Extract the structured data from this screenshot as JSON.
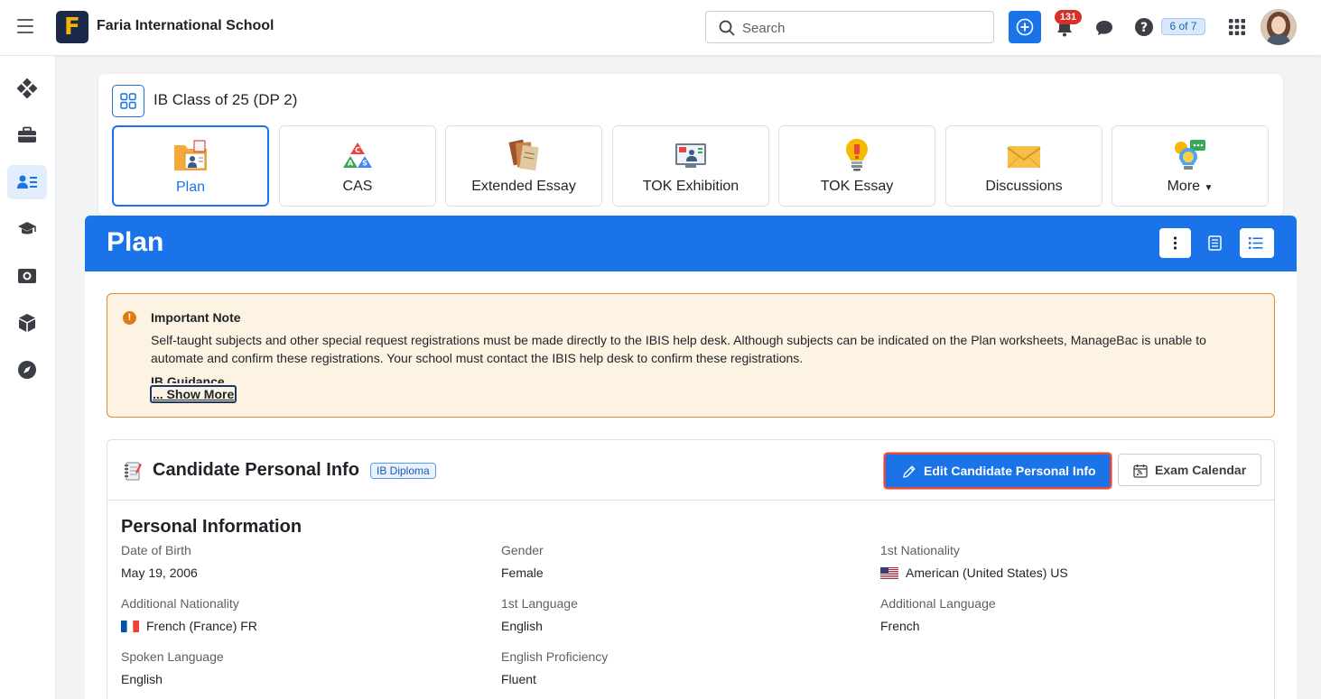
{
  "header": {
    "school_name": "Faria International School",
    "search_placeholder": "Search",
    "notifications_count": "131",
    "pager": "6 of 7"
  },
  "sidebar": {
    "items": [
      {
        "icon": "diamond-grid-icon"
      },
      {
        "icon": "briefcase-icon"
      },
      {
        "icon": "student-card-icon",
        "active": true
      },
      {
        "icon": "graduation-cap-icon"
      },
      {
        "icon": "book-globe-icon"
      },
      {
        "icon": "cube-icon"
      },
      {
        "icon": "compass-icon"
      }
    ]
  },
  "class": {
    "title": "IB Class of 25 (DP 2)",
    "tabs": [
      {
        "label": "Plan",
        "icon": "plan-folder-icon",
        "active": true
      },
      {
        "label": "CAS",
        "icon": "cas-triangle-icon"
      },
      {
        "label": "Extended Essay",
        "icon": "extended-essay-books-icon"
      },
      {
        "label": "TOK Exhibition",
        "icon": "tok-exhibition-screen-icon"
      },
      {
        "label": "TOK Essay",
        "icon": "tok-essay-lightbulb-icon"
      },
      {
        "label": "Discussions",
        "icon": "discussions-envelope-icon"
      },
      {
        "label": "More",
        "icon": "more-bulb-chat-icon",
        "dropdown": true
      }
    ]
  },
  "plan": {
    "title": "Plan"
  },
  "note": {
    "title": "Important Note",
    "body": "Self-taught subjects and other special request registrations must be made directly to the IBIS help desk. Although subjects can be indicated on the Plan worksheets, ManageBac is unable to automate and confirm these registrations. Your school must contact the IBIS help desk to confirm these registrations.",
    "subheading": "IB Guidance",
    "show_more": "... Show More"
  },
  "candidate": {
    "title": "Candidate Personal Info",
    "badge": "IB Diploma",
    "edit_label": "Edit Candidate Personal Info",
    "calendar_label": "Exam Calendar",
    "section_title": "Personal Information",
    "fields": [
      {
        "label": "Date of Birth",
        "value": "May 19, 2006"
      },
      {
        "label": "Gender",
        "value": "Female"
      },
      {
        "label": "1st Nationality",
        "value": "American (United States) US",
        "flag": "us"
      },
      {
        "label": "Additional Nationality",
        "value": "French (France) FR",
        "flag": "fr"
      },
      {
        "label": "1st Language",
        "value": "English"
      },
      {
        "label": "Additional Language",
        "value": "French"
      },
      {
        "label": "Spoken Language",
        "value": "English"
      },
      {
        "label": "English Proficiency",
        "value": "Fluent"
      }
    ]
  },
  "colors": {
    "accent": "#1a73e8",
    "note_border": "#e08a2e",
    "note_bg": "#fdf3e3",
    "badge_red": "#d93025"
  }
}
